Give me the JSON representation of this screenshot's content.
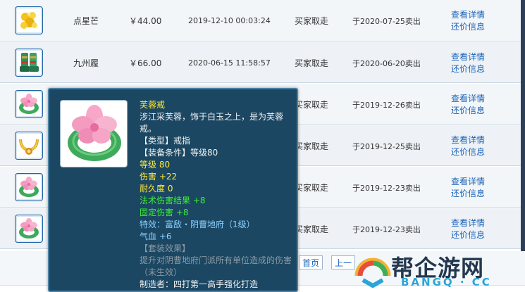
{
  "rows": [
    {
      "name": "点星芒",
      "price": "￥44.00",
      "time": "2019-12-10 00:03:24",
      "status": "买家取走",
      "sold": "于2020-07-25卖出",
      "icon": "gold-flower-icon"
    },
    {
      "name": "九州履",
      "price": "￥66.00",
      "time": "2020-06-15 11:58:57",
      "status": "买家取走",
      "sold": "于2020-06-20卖出",
      "icon": "green-boots-icon"
    },
    {
      "name": "",
      "price": "",
      "time": "",
      "status": "买家取走",
      "sold": "于2019-12-26卖出",
      "icon": "jade-ring-icon"
    },
    {
      "name": "",
      "price": "",
      "time": "",
      "status": "买家取走",
      "sold": "于2019-12-25卖出",
      "icon": "gold-necklace-icon"
    },
    {
      "name": "",
      "price": "",
      "time": "",
      "status": "买家取走",
      "sold": "于2019-12-23卖出",
      "icon": "jade-ring-icon"
    },
    {
      "name": "",
      "price": "",
      "time": "",
      "status": "买家取走",
      "sold": "于2019-12-23卖出",
      "icon": "jade-ring-icon"
    }
  ],
  "links": {
    "detail": "查看详情",
    "bargain": "还价信息"
  },
  "pagination": {
    "first": "首页",
    "prev": "上一"
  },
  "tooltip": {
    "name": "芙蓉戒",
    "desc": "涉江采芙蓉，饰于白玉之上，是为芙蓉戒。",
    "type": "【类型】戒指",
    "requirement": "【装备条件】等级80",
    "level": "等级 80",
    "damage": "伤害 +22",
    "durability": "耐久度 0",
    "spell_result": "法术伤害结果 +8",
    "fixed_damage": "固定伤害 +8",
    "effect": "特效：富敌・阴曹地府（1级）",
    "hp": "气血 +6",
    "set_title": "【套装效果】",
    "set_desc": "提升对阴曹地府门派所有单位造成的伤害（未生效）",
    "maker": "制造者：四打第一高手强化打造"
  },
  "watermark": {
    "brand": "帮企游网",
    "sub": "BANGQ · CC"
  },
  "colors": {
    "link": "#1a63b8",
    "tooltip_bg": "#1b4763",
    "yellow": "#ffea3a",
    "green": "#39f22f",
    "blue": "#8ad0ff"
  }
}
